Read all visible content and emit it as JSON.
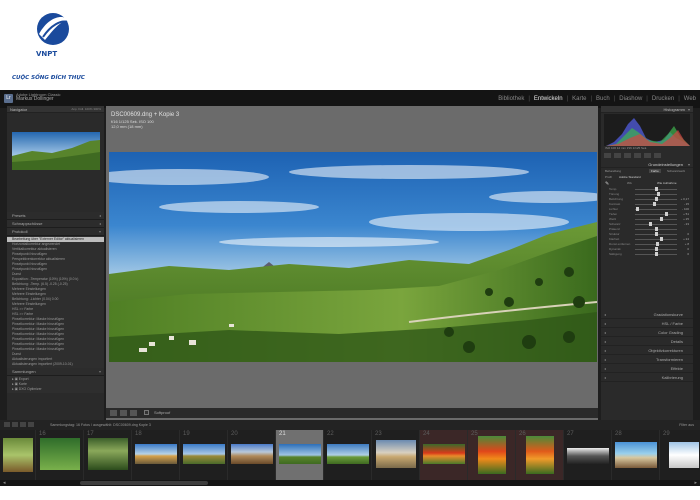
{
  "brand": {
    "name": "VNPT",
    "slogan": "CUỘC SỐNG ĐÍCH THỰC",
    "colors": {
      "primary": "#1a4a9c"
    }
  },
  "app": {
    "user_line1": "Adobe Lightroom Classic",
    "user_line2": "Markus Dollinger",
    "modules": [
      "Bibliothek",
      "Entwickeln",
      "Karte",
      "Buch",
      "Diashow",
      "Drucken",
      "Web"
    ],
    "active_module": "Entwickeln"
  },
  "left_panel": {
    "navigator_title": "Navigator",
    "navigator_zoom": "Anp.  Füll.  100%  300%",
    "sections": [
      "Presets",
      "Schnappschüsse",
      "Protokoll"
    ],
    "history_items": [
      "Bearbeitung über \"Externer Editor\" aktualisieren",
      "Horizontalkorrektur angewendet",
      "Vertikalkorrektur aktualisieren",
      "Pinselpunkt hinzufügen",
      "Perspektivenkorrektur aktualisieren",
      "Pinselpunkt hinzufügen",
      "Pinselpunkt hinzufügen",
      "Dunst",
      "Exposition: -Temperatur (10%) (10%) (0.0 k)",
      "Belichtung: -Temp. (6.5) -0.25 (-0.25)",
      "Mehrere Einstellungen",
      "Mehrere Einstellungen",
      "Belichtung: -Lichter (0.04) 0.00",
      "Mehrere Einstellungen",
      "HSL >> Farbe",
      "HSL >> Farbe",
      "Pinselkorrektur: Maske hinzufügen",
      "Pinselkorrektur: Maske hinzufügen",
      "Pinselkorrektur: Maske hinzufügen",
      "Pinselkorrektur: Maske hinzufügen",
      "Pinselkorrektur: Maske hinzufügen",
      "Pinselkorrektur: Maske hinzufügen",
      "Pinselkorrektur: Maske hinzufügen",
      "Dunst",
      "Aktualisierungen importiert",
      "Aktualisierungen importiert (2009-10-01)"
    ],
    "selected_history_index": 0,
    "collections_title": "Sammlungen",
    "collections": [
      "Export",
      "Karte",
      "DXO Optimizer"
    ],
    "copy_button": "Kopieren...",
    "paste_button": "Einfügen"
  },
  "center": {
    "title": "DSC00609.dng + Kopie 3",
    "meta1": "f/16  1/125 Sek.  ISO 100",
    "meta2": "12,0 mm (18 mm)",
    "toolbar_label": "Softproof"
  },
  "right_panel": {
    "histogram_title": "Histogramm",
    "histogram_info": "ISO 100    12 mm    f/16    1/125 Sek.",
    "basic_title": "Grundeinstellungen",
    "treatment_label": "Behandlung",
    "treatment_options": [
      "Farbe",
      "Schwarzweiß"
    ],
    "profile_label": "Profil",
    "profile_value": "Adobe Standard",
    "wb_label": "WA",
    "wb_value": "Wie Aufnahme",
    "tone_label": "Farbton",
    "auto_label": "Autom.",
    "sliders": [
      {
        "label": "Temp.",
        "value": "",
        "pos": 0.5
      },
      {
        "label": "Tönung",
        "value": "",
        "pos": 0.55
      },
      {
        "label": "Belichtung",
        "value": "+ 0,17",
        "pos": 0.52
      },
      {
        "label": "Kontrast",
        "value": "- 15",
        "pos": 0.46
      },
      {
        "label": "Lichter",
        "value": "- 100",
        "pos": 0.05
      },
      {
        "label": "Tiefen",
        "value": "+ 51",
        "pos": 0.75
      },
      {
        "label": "Weiß",
        "value": "+ 25",
        "pos": 0.62
      },
      {
        "label": "Schwarz",
        "value": "- 23",
        "pos": 0.38
      },
      {
        "label": "Präsenz",
        "value": "",
        "pos": 0.5
      },
      {
        "label": "Struktur",
        "value": "0",
        "pos": 0.5
      },
      {
        "label": "Klarheit",
        "value": "+ 24",
        "pos": 0.62
      },
      {
        "label": "Dunst entfernen",
        "value": "+ 8",
        "pos": 0.54
      },
      {
        "label": "Dynamik",
        "value": "0",
        "pos": 0.5
      },
      {
        "label": "Sättigung",
        "value": "0",
        "pos": 0.5
      }
    ],
    "collapsed_sections": [
      "Gradationskurve",
      "HSL / Farbe",
      "Color Grading",
      "Details",
      "Objektivkorrekturen",
      "Transformieren",
      "Effekte",
      "Kalibrierung"
    ],
    "prev_button": "Vorherige",
    "reset_button": "Zurücksetzen"
  },
  "filmstrip_header": {
    "info": "Sammlungstag: 16 Fotos / ausgewählt: DSC00609.dng Kopie 3",
    "filter": "Filter aus"
  },
  "filmstrip": {
    "numbers": [
      "",
      "16",
      "17",
      "18",
      "19",
      "20",
      "21",
      "22",
      "23",
      "24",
      "25",
      "26",
      "27",
      "28",
      "29"
    ],
    "selected_number": "21"
  }
}
